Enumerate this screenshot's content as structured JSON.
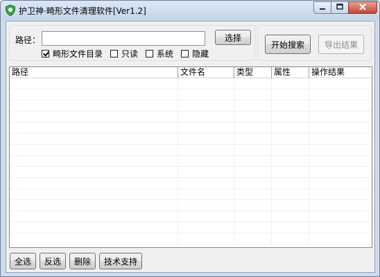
{
  "window": {
    "title": "护卫神·畸形文件清理软件[Ver1.2]"
  },
  "path_group": {
    "label": "路径：",
    "input_value": "",
    "select_button": "选择",
    "options": [
      {
        "label": "畸形文件目录",
        "checked": true
      },
      {
        "label": "只读",
        "checked": false
      },
      {
        "label": "系统",
        "checked": false
      },
      {
        "label": "隐藏",
        "checked": false
      }
    ]
  },
  "actions": {
    "start_label": "开始搜索",
    "export_label": "导出结果",
    "export_disabled": true
  },
  "table": {
    "columns": [
      "路径",
      "文件名",
      "类型",
      "属性",
      "操作结果"
    ],
    "rows": []
  },
  "footer": {
    "select_all": "全选",
    "invert": "反选",
    "delete": "删除",
    "support": "技术支持"
  },
  "colors": {
    "frame": "#cfdcec",
    "close_button": "#c7452f",
    "shield_icon": "#3aa647"
  }
}
